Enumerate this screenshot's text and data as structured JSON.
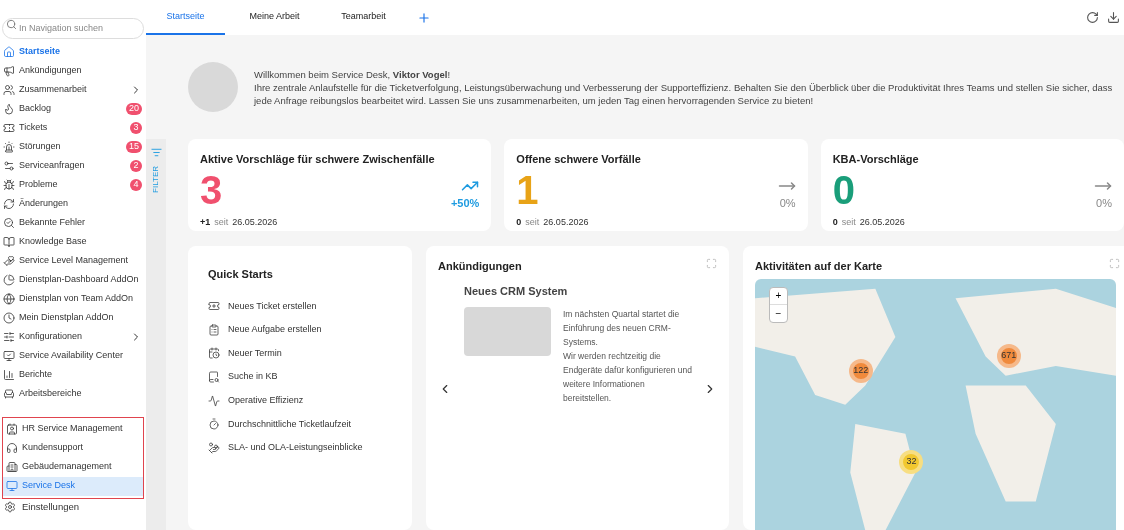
{
  "sidebar": {
    "search": {
      "placeholder": "In Navigation suchen"
    },
    "items": [
      {
        "label": "Startseite",
        "selected": true
      },
      {
        "label": "Ankündigungen",
        "selected": false
      },
      {
        "label": "Zusammenarbeit",
        "selected": false,
        "has_submenu": true
      },
      {
        "label": "Backlog",
        "selected": false,
        "badge": "20"
      },
      {
        "label": "Tickets",
        "selected": false,
        "badge": "3"
      },
      {
        "label": "Störungen",
        "selected": false,
        "badge": "15"
      },
      {
        "label": "Serviceanfragen",
        "selected": false,
        "badge": "2"
      },
      {
        "label": "Probleme",
        "selected": false,
        "badge": "4"
      },
      {
        "label": "Änderungen",
        "selected": false
      },
      {
        "label": "Bekannte Fehler",
        "selected": false
      },
      {
        "label": "Knowledge Base",
        "selected": false
      },
      {
        "label": "Service Level Management",
        "selected": false
      },
      {
        "label": "Dienstplan-Dashboard AddOn",
        "selected": false
      },
      {
        "label": "Dienstplan von Team AddOn",
        "selected": false
      },
      {
        "label": "Mein Dienstplan AddOn",
        "selected": false
      },
      {
        "label": "Konfigurationen",
        "selected": false,
        "has_submenu": true
      },
      {
        "label": "Service Availability Center",
        "selected": false
      },
      {
        "label": "Berichte",
        "selected": false
      },
      {
        "label": "Arbeitsbereiche",
        "selected": false
      }
    ],
    "workspaces": [
      {
        "label": "HR Service Management",
        "selected": false
      },
      {
        "label": "Kundensupport",
        "selected": false
      },
      {
        "label": "Gebäudemanagement",
        "selected": false
      },
      {
        "label": "Service Desk",
        "selected": true
      }
    ],
    "footer_item": "Einstellungen"
  },
  "filter_label": "FILTER",
  "tabs": [
    {
      "label": "Startseite",
      "selected": true
    },
    {
      "label": "Meine Arbeit",
      "selected": false
    },
    {
      "label": "Teamarbeit",
      "selected": false
    }
  ],
  "welcome": {
    "greeting": "Willkommen beim Service Desk, **Viktor Vogel**!",
    "text": "Ihre zentrale Anlaufstelle für die Ticketverfolgung, Leistungsüberwachung und Verbesserung der Supporteffizienz. Behalten Sie den Überblick über die Produktivität Ihres Teams und stellen Sie sicher, dass jede Anfrage reibungslos bearbeitet wird. Lassen Sie uns zusammenarbeiten, um jeden Tag einen hervorragenden Service zu bieten!"
  },
  "stats": [
    {
      "title": "Aktive Vorschläge für schwere Zwischenfälle",
      "value": "3",
      "color": "#f0506e",
      "delta": "+1",
      "since": "seit",
      "date": "26.05.2026",
      "kind": "up",
      "change": "+50%"
    },
    {
      "title": "Offene schwere Vorfälle",
      "value": "1",
      "color": "#e8a317",
      "delta": "0",
      "since": "seit",
      "date": "26.05.2026",
      "kind": "flat",
      "change": "0%"
    },
    {
      "title": "KBA-Vorschläge",
      "value": "0",
      "color": "#1a9e7a",
      "delta": "0",
      "since": "seit",
      "date": "26.05.2026",
      "kind": "flat",
      "change": "0%"
    }
  ],
  "quick_starts": {
    "title": "Quick Starts",
    "items": [
      "Neues Ticket erstellen",
      "Neue Aufgabe erstellen",
      "Neuer Termin",
      "Suche in KB",
      "Operative Effizienz",
      "Durchschnittliche Ticketlaufzeit",
      "SLA- und OLA-Leistungseinblicke"
    ]
  },
  "announcements": {
    "title": "Ankündigungen",
    "item": {
      "title": "Neues CRM System",
      "text": "Im nächsten Quartal startet die Einführung des neuen CRM-Systems.\nWir werden rechtzeitig die Endgeräte dafür konfigurieren und weitere Informationen bereitstellen."
    }
  },
  "map": {
    "title": "Aktivitäten auf der Karte",
    "zoom_in": "+",
    "zoom_out": "−",
    "clusters": [
      {
        "count": "122",
        "color": "#f08a3c"
      },
      {
        "count": "671",
        "color": "#f08a3c"
      },
      {
        "count": "32",
        "color": "#f2c830"
      }
    ]
  }
}
